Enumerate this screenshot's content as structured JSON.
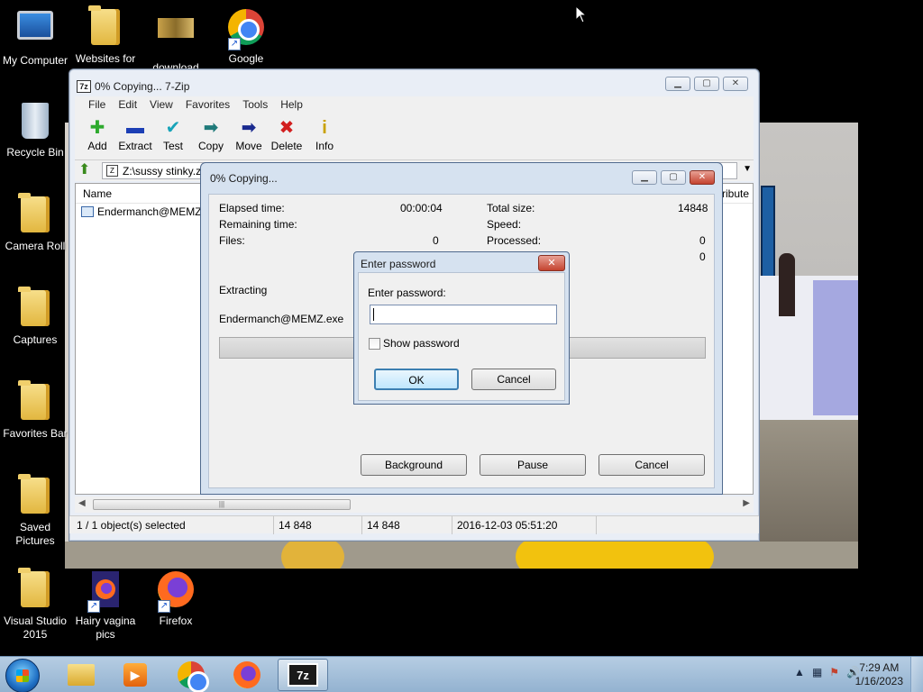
{
  "desktop": {
    "icons": [
      {
        "label": "My Computer"
      },
      {
        "label": "Websites for"
      },
      {
        "label": "download"
      },
      {
        "label": "Google"
      },
      {
        "label": "Recycle Bin"
      },
      {
        "label": "Camera Roll"
      },
      {
        "label": "Captures"
      },
      {
        "label": "Favorites Bar"
      },
      {
        "label": "Saved Pictures"
      },
      {
        "label": "Visual Studio 2015"
      },
      {
        "label": "Hairy vagina pics"
      },
      {
        "label": "Firefox"
      }
    ]
  },
  "main_window": {
    "title": "0% Copying... 7-Zip",
    "app_badge": "7z",
    "menu": [
      "File",
      "Edit",
      "View",
      "Favorites",
      "Tools",
      "Help"
    ],
    "toolbar": [
      {
        "label": "Add",
        "glyph": "✚",
        "color": "#2eaa2e"
      },
      {
        "label": "Extract",
        "glyph": "▬",
        "color": "#1c3fb5"
      },
      {
        "label": "Test",
        "glyph": "✔",
        "color": "#17a3b8"
      },
      {
        "label": "Copy",
        "glyph": "➡",
        "color": "#1f7a7a"
      },
      {
        "label": "Move",
        "glyph": "➡",
        "color": "#1a2a8f"
      },
      {
        "label": "Delete",
        "glyph": "✖",
        "color": "#d21f1f"
      },
      {
        "label": "Info",
        "glyph": "i",
        "color": "#c9a100"
      }
    ],
    "address": "Z:\\sussy stinky.z",
    "columns": {
      "name": "Name",
      "attributes": "ttribute"
    },
    "files": [
      {
        "name": "Endermanch@MEMZ.e"
      }
    ],
    "status": {
      "selected": "1 / 1 object(s) selected",
      "size": "14 848",
      "packed": "14 848",
      "modified": "2016-12-03 05:51:20"
    }
  },
  "copy_dialog": {
    "title": "0% Copying...",
    "elapsed_label": "Elapsed time:",
    "elapsed_value": "00:00:04",
    "remaining_label": "Remaining time:",
    "files_label": "Files:",
    "files_value": "0",
    "total_label": "Total size:",
    "total_value": "14848",
    "speed_label": "Speed:",
    "processed_label": "Processed:",
    "processed_value": "0",
    "extra_value": "0",
    "action": "Extracting",
    "current_file": "Endermanch@MEMZ.exe",
    "progress": 0,
    "buttons": {
      "background": "Background",
      "pause": "Pause",
      "cancel": "Cancel"
    }
  },
  "password_dialog": {
    "title": "Enter password",
    "prompt": "Enter password:",
    "value": "",
    "show_password_label": "Show password",
    "show_password_checked": false,
    "ok": "OK",
    "cancel": "Cancel"
  },
  "taskbar": {
    "pinned": [
      "explorer",
      "media-player",
      "chrome",
      "firefox",
      "7-zip"
    ],
    "active_label": "7z",
    "clock_time": "7:29 AM",
    "clock_date": "1/16/2023"
  },
  "colors": {
    "taskbar": "#a5c0dc",
    "title_close": "#c4432f",
    "desktop": "#000000"
  }
}
